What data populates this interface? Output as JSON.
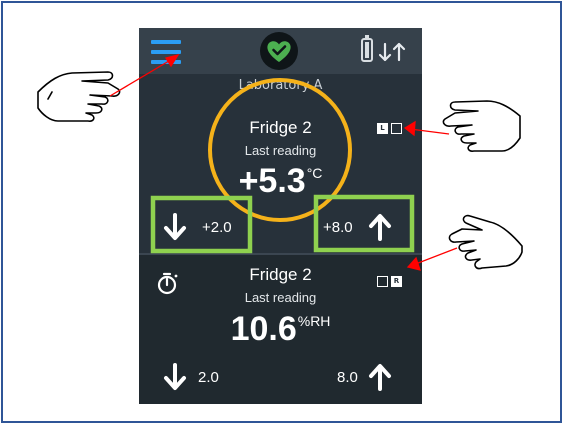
{
  "header": {
    "menu_icon": "hamburger-menu-icon",
    "status_icon": "heart-check-icon",
    "battery_icon": "battery-icon",
    "sync_icon": "sync-arrows-icon",
    "location": "Laboratory A"
  },
  "sensors": [
    {
      "name": "Fridge 2",
      "reading_label": "Last reading",
      "value": "+5.3",
      "unit": "°C",
      "low_limit": "+2.0",
      "high_limit": "+8.0",
      "channel_letters": [
        "L",
        ""
      ],
      "active_channel": "L"
    },
    {
      "name": "Fridge 2",
      "reading_label": "Last reading",
      "value": "10.6",
      "unit": "%RH",
      "low_limit": "2.0",
      "high_limit": "8.0",
      "channel_letters": [
        "",
        "R"
      ],
      "active_channel": "R",
      "icon": "stopwatch-icon"
    }
  ],
  "colors": {
    "accent_blue": "#2b9df4",
    "status_green": "#4caf50",
    "highlight_circle": "#f5b21a",
    "highlight_box": "#8fd14f",
    "pointer_arrow": "#ff0000",
    "device_background": "#27313a"
  }
}
